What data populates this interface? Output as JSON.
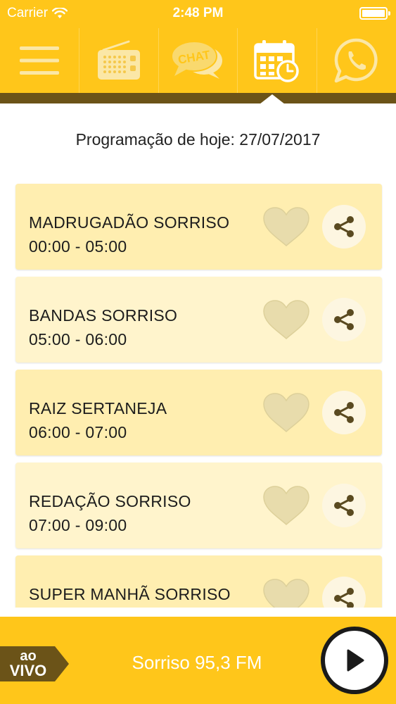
{
  "status_bar": {
    "carrier": "Carrier",
    "time": "2:48 PM"
  },
  "nav": {
    "items": [
      {
        "icon": "menu-icon"
      },
      {
        "icon": "radio-icon"
      },
      {
        "icon": "chat-icon",
        "label": "CHAT"
      },
      {
        "icon": "calendar-schedule-icon",
        "active": true
      },
      {
        "icon": "whatsapp-icon"
      }
    ]
  },
  "schedule": {
    "title": "Programação de hoje: 27/07/2017",
    "programs": [
      {
        "name": "MADRUGADÃO SORRISO",
        "time": "00:00  -  05:00"
      },
      {
        "name": "BANDAS SORRISO",
        "time": "05:00  -  06:00"
      },
      {
        "name": "RAIZ SERTANEJA",
        "time": "06:00  -  07:00"
      },
      {
        "name": "REDAÇÃO SORRISO",
        "time": "07:00  -  09:00"
      },
      {
        "name": "SUPER MANHÃ SORRISO",
        "time": ""
      }
    ]
  },
  "player": {
    "live_top": "ao",
    "live_bottom": "VIVO",
    "station": "Sorriso 95,3 FM"
  },
  "colors": {
    "brand_yellow": "#ffc61a",
    "dark_strip": "#6b5318",
    "card_a": "#ffeeb0",
    "card_b": "#fff4cc",
    "heart": "#e6dcae",
    "share_icon": "#5a4a20"
  }
}
